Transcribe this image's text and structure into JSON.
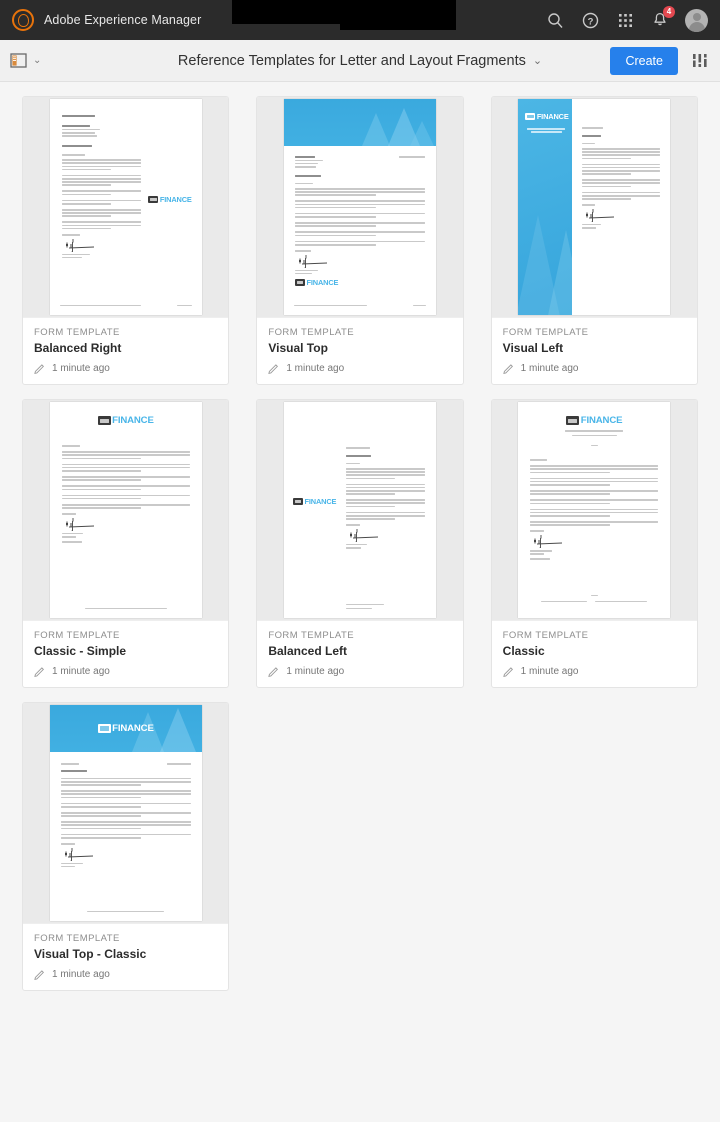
{
  "topbar": {
    "brand": "Adobe Experience Manager",
    "logo_icon": "adobe-logo-icon",
    "icons": [
      {
        "name": "search-icon",
        "label": "Search"
      },
      {
        "name": "help-icon",
        "label": "Help"
      },
      {
        "name": "solutions-grid-icon",
        "label": "Solutions"
      },
      {
        "name": "bell-icon",
        "label": "Notifications"
      }
    ],
    "notification_count": "4",
    "avatar_name": "avatar"
  },
  "actionbar": {
    "rail_icon": "rail-toggle-icon",
    "rail_chevron": "⌄",
    "title": "Reference Templates for Letter and Layout Fragments",
    "title_chevron": "⌄",
    "create_label": "Create",
    "view_settings_icon": "view-settings-icon"
  },
  "colors": {
    "accent_blue": "#2680eb",
    "brand_blue": "#41b0e2",
    "logo_blue": "#49b5e8",
    "badge_red": "#e34850",
    "topbar_bg": "#2b2b2b",
    "content_bg": "#f5f5f5"
  },
  "logo": {
    "text": "FINANCE"
  },
  "cards": [
    {
      "kind": "FORM TEMPLATE",
      "title": "Balanced Right",
      "modified": "1 minute ago",
      "layout": "balanced-right",
      "edit_icon": "pencil-icon"
    },
    {
      "kind": "FORM TEMPLATE",
      "title": "Visual Top",
      "modified": "1 minute ago",
      "layout": "visual-top",
      "edit_icon": "pencil-icon"
    },
    {
      "kind": "FORM TEMPLATE",
      "title": "Visual Left",
      "modified": "1 minute ago",
      "layout": "visual-left",
      "edit_icon": "pencil-icon"
    },
    {
      "kind": "FORM TEMPLATE",
      "title": "Classic - Simple",
      "modified": "1 minute ago",
      "layout": "classic-simple",
      "edit_icon": "pencil-icon"
    },
    {
      "kind": "FORM TEMPLATE",
      "title": "Balanced Left",
      "modified": "1 minute ago",
      "layout": "balanced-left",
      "edit_icon": "pencil-icon"
    },
    {
      "kind": "FORM TEMPLATE",
      "title": "Classic",
      "modified": "1 minute ago",
      "layout": "classic",
      "edit_icon": "pencil-icon"
    },
    {
      "kind": "FORM TEMPLATE",
      "title": "Visual Top - Classic",
      "modified": "1 minute ago",
      "layout": "visual-top-classic",
      "edit_icon": "pencil-icon"
    }
  ]
}
